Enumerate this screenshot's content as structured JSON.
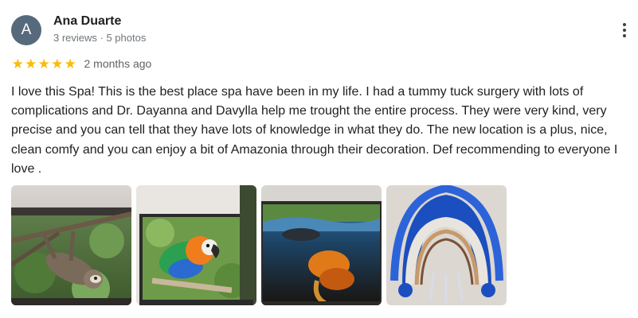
{
  "reviewer": {
    "initial": "A",
    "name": "Ana Duarte",
    "meta": "3 reviews · 5 photos",
    "avatar_color": "#566a7c"
  },
  "rating": {
    "stars": 5,
    "max": 5,
    "star_color": "#fbbc04",
    "date": "2 months ago"
  },
  "review_text": "I love this Spa! This is the best place spa have been in my life. I had a tummy tuck surgery with lots of complications and Dr. Dayanna and Davylla help me trought the entire process. They were very kind, very precise and you can tell that they have lots of knowledge in what they do. The new location is a plus, nice, clean comfy and you can enjoy a bit of Amazonia through their decoration. Def recommending to everyone I love .",
  "photos": [
    {
      "subject": "sloth"
    },
    {
      "subject": "macaw"
    },
    {
      "subject": "underwater"
    },
    {
      "subject": "feather-headdress"
    }
  ],
  "icons": {
    "more": "more-vert-icon",
    "star": "star-icon"
  }
}
